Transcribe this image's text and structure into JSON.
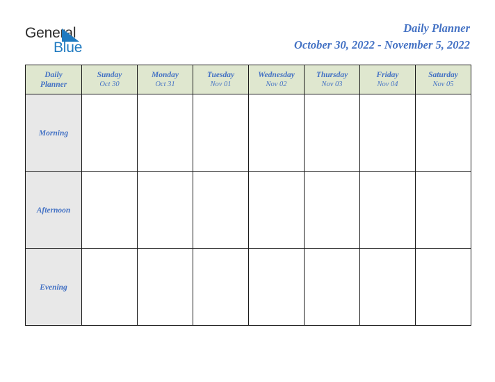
{
  "brand": {
    "name_dark": "General",
    "name_blue": "Blue",
    "mark": "triangle-logo-mark",
    "dark_color": "#2b2b2b",
    "blue_color": "#1f7ac0"
  },
  "header": {
    "title": "Daily Planner",
    "date_range": "October 30, 2022 - November 5, 2022",
    "accent_color": "#4472c4"
  },
  "table": {
    "corner_label_line1": "Daily",
    "corner_label_line2": "Planner",
    "header_bg": "#dfe7cf",
    "row_label_bg": "#e8e8e8",
    "border_color": "#1a1a1a",
    "columns": [
      {
        "day": "Sunday",
        "date": "Oct 30"
      },
      {
        "day": "Monday",
        "date": "Oct 31"
      },
      {
        "day": "Tuesday",
        "date": "Nov 01"
      },
      {
        "day": "Wednesday",
        "date": "Nov 02"
      },
      {
        "day": "Thursday",
        "date": "Nov 03"
      },
      {
        "day": "Friday",
        "date": "Nov 04"
      },
      {
        "day": "Saturday",
        "date": "Nov 05"
      }
    ],
    "rows": [
      {
        "label": "Morning",
        "cells": [
          "",
          "",
          "",
          "",
          "",
          "",
          ""
        ]
      },
      {
        "label": "Afternoon",
        "cells": [
          "",
          "",
          "",
          "",
          "",
          "",
          ""
        ]
      },
      {
        "label": "Evening",
        "cells": [
          "",
          "",
          "",
          "",
          "",
          "",
          ""
        ]
      }
    ]
  }
}
